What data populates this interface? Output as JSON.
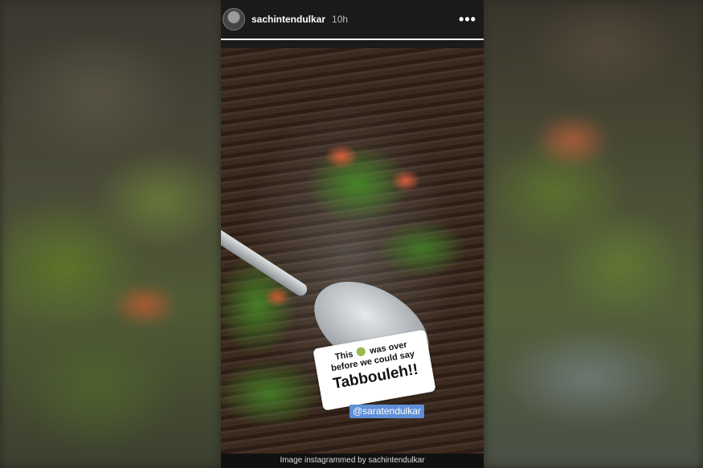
{
  "story": {
    "username": "sachintendulkar",
    "timestamp": "10h",
    "more_icon": "more-options-icon",
    "progress": 1.0
  },
  "stickers": {
    "caption_line1_before": "This",
    "caption_line1_after": "was over",
    "caption_line2": "before we could say",
    "caption_line3": "Tabbouleh!!",
    "emoji": "sick-face-emoji",
    "mention": "@saratendulkar"
  },
  "credit": "Image instagrammed by sachintendulkar"
}
